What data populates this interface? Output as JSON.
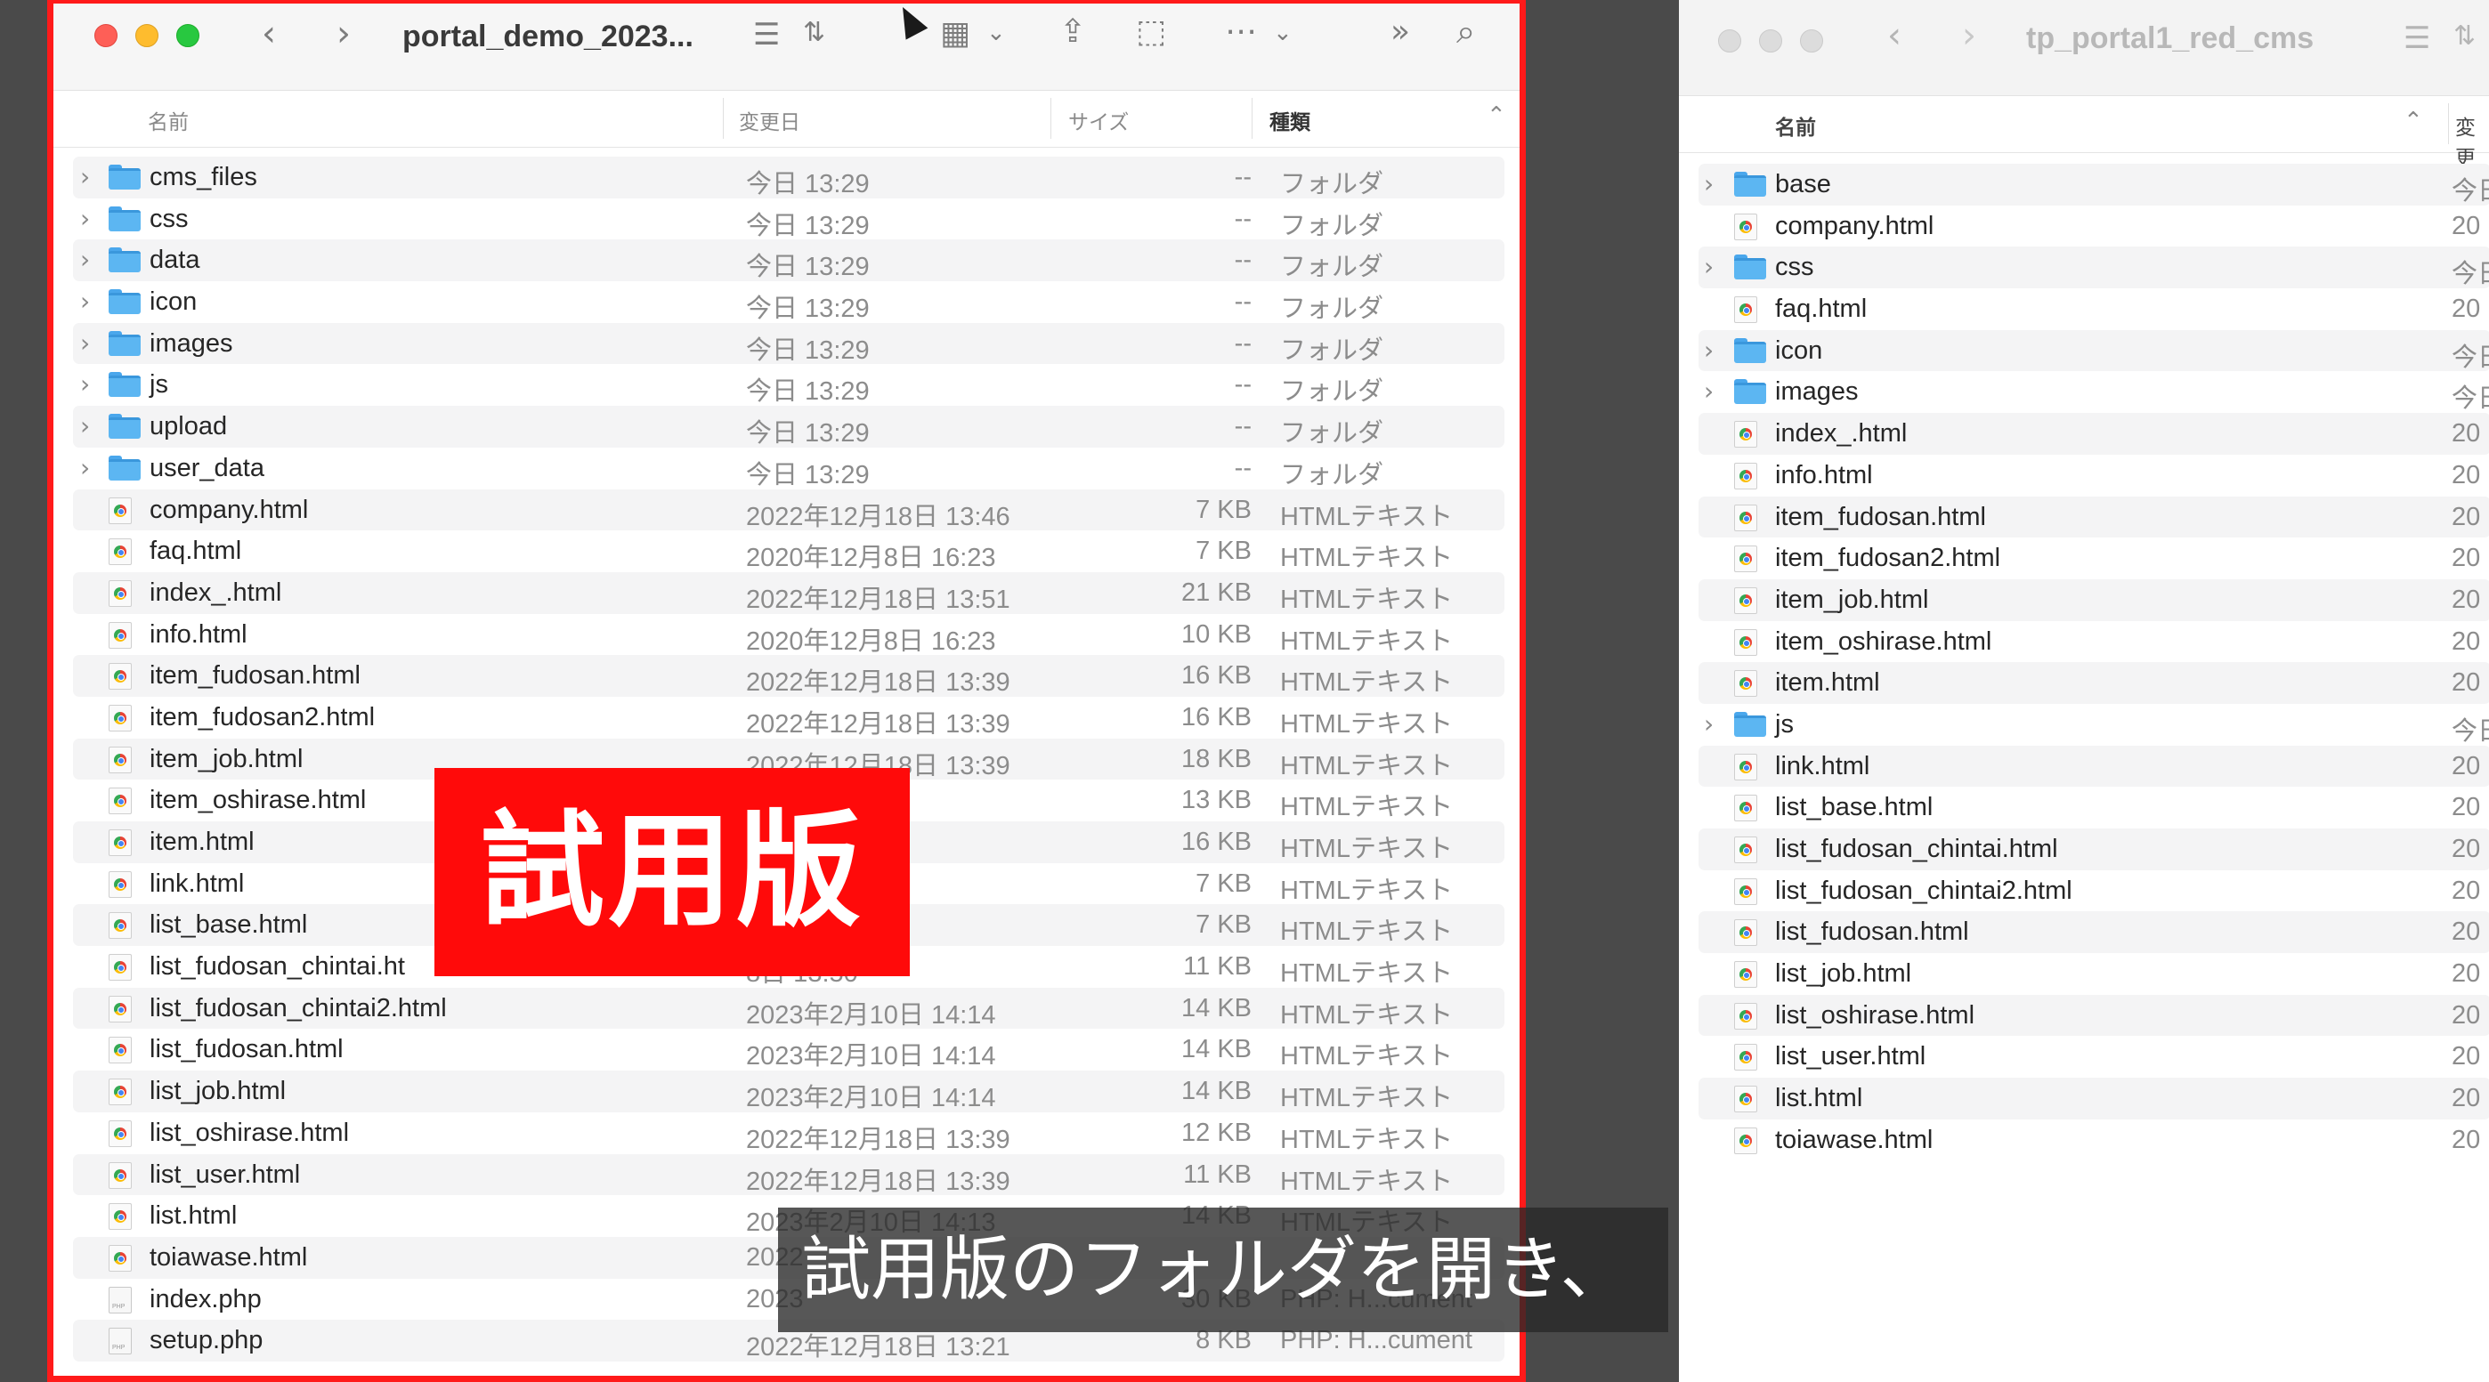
{
  "left_window": {
    "title": "portal_demo_2023...",
    "columns": {
      "name": "名前",
      "date": "変更日",
      "size": "サイズ",
      "kind": "種類"
    },
    "files": [
      {
        "name": "cms_files",
        "date": "今日 13:29",
        "size": "--",
        "kind": "フォルダ",
        "type": "folder"
      },
      {
        "name": "css",
        "date": "今日 13:29",
        "size": "--",
        "kind": "フォルダ",
        "type": "folder"
      },
      {
        "name": "data",
        "date": "今日 13:29",
        "size": "--",
        "kind": "フォルダ",
        "type": "folder"
      },
      {
        "name": "icon",
        "date": "今日 13:29",
        "size": "--",
        "kind": "フォルダ",
        "type": "folder"
      },
      {
        "name": "images",
        "date": "今日 13:29",
        "size": "--",
        "kind": "フォルダ",
        "type": "folder"
      },
      {
        "name": "js",
        "date": "今日 13:29",
        "size": "--",
        "kind": "フォルダ",
        "type": "folder"
      },
      {
        "name": "upload",
        "date": "今日 13:29",
        "size": "--",
        "kind": "フォルダ",
        "type": "folder"
      },
      {
        "name": "user_data",
        "date": "今日 13:29",
        "size": "--",
        "kind": "フォルダ",
        "type": "folder"
      },
      {
        "name": "company.html",
        "date": "2022年12月18日 13:46",
        "size": "7 KB",
        "kind": "HTMLテキスト",
        "type": "html"
      },
      {
        "name": "faq.html",
        "date": "2020年12月8日 16:23",
        "size": "7 KB",
        "kind": "HTMLテキスト",
        "type": "html"
      },
      {
        "name": "index_.html",
        "date": "2022年12月18日 13:51",
        "size": "21 KB",
        "kind": "HTMLテキスト",
        "type": "html"
      },
      {
        "name": "info.html",
        "date": "2020年12月8日 16:23",
        "size": "10 KB",
        "kind": "HTMLテキスト",
        "type": "html"
      },
      {
        "name": "item_fudosan.html",
        "date": "2022年12月18日 13:39",
        "size": "16 KB",
        "kind": "HTMLテキスト",
        "type": "html"
      },
      {
        "name": "item_fudosan2.html",
        "date": "2022年12月18日 13:39",
        "size": "16 KB",
        "kind": "HTMLテキスト",
        "type": "html"
      },
      {
        "name": "item_job.html",
        "date": "2022年12月18日 13:39",
        "size": "18 KB",
        "kind": "HTMLテキスト",
        "type": "html"
      },
      {
        "name": "item_oshirase.html",
        "date": "8日 13:39",
        "size": "13 KB",
        "kind": "HTMLテキスト",
        "type": "html"
      },
      {
        "name": "item.html",
        "date": "8日 13:39",
        "size": "16 KB",
        "kind": "HTMLテキスト",
        "type": "html"
      },
      {
        "name": "link.html",
        "date": "日 16:23",
        "size": "7 KB",
        "kind": "HTMLテキスト",
        "type": "html"
      },
      {
        "name": "list_base.html",
        "date": "日 16:23",
        "size": "7 KB",
        "kind": "HTMLテキスト",
        "type": "html"
      },
      {
        "name": "list_fudosan_chintai.ht",
        "date": "8日 13:50",
        "size": "11 KB",
        "kind": "HTMLテキスト",
        "type": "html"
      },
      {
        "name": "list_fudosan_chintai2.html",
        "date": "2023年2月10日 14:14",
        "size": "14 KB",
        "kind": "HTMLテキスト",
        "type": "html"
      },
      {
        "name": "list_fudosan.html",
        "date": "2023年2月10日 14:14",
        "size": "14 KB",
        "kind": "HTMLテキスト",
        "type": "html"
      },
      {
        "name": "list_job.html",
        "date": "2023年2月10日 14:14",
        "size": "14 KB",
        "kind": "HTMLテキスト",
        "type": "html"
      },
      {
        "name": "list_oshirase.html",
        "date": "2022年12月18日 13:39",
        "size": "12 KB",
        "kind": "HTMLテキスト",
        "type": "html"
      },
      {
        "name": "list_user.html",
        "date": "2022年12月18日 13:39",
        "size": "11 KB",
        "kind": "HTMLテキスト",
        "type": "html"
      },
      {
        "name": "list.html",
        "date": "2023年2月10日 14:13",
        "size": "14 KB",
        "kind": "HTMLテキスト",
        "type": "html"
      },
      {
        "name": "toiawase.html",
        "date": "2022",
        "size": "",
        "kind": "",
        "type": "html"
      },
      {
        "name": "index.php",
        "date": "2023",
        "size": "30 KB",
        "kind": "PHP: H...cument",
        "type": "php"
      },
      {
        "name": "setup.php",
        "date": "2022年12月18日 13:21",
        "size": "8 KB",
        "kind": "PHP: H...cument",
        "type": "php"
      }
    ]
  },
  "right_window": {
    "title": "tp_portal1_red_cms",
    "columns": {
      "name": "名前",
      "date": "変更"
    },
    "files": [
      {
        "name": "base",
        "date": "今日",
        "type": "folder"
      },
      {
        "name": "company.html",
        "date": "20",
        "type": "html"
      },
      {
        "name": "css",
        "date": "今日",
        "type": "folder"
      },
      {
        "name": "faq.html",
        "date": "20",
        "type": "html"
      },
      {
        "name": "icon",
        "date": "今日",
        "type": "folder"
      },
      {
        "name": "images",
        "date": "今日",
        "type": "folder"
      },
      {
        "name": "index_.html",
        "date": "20",
        "type": "html"
      },
      {
        "name": "info.html",
        "date": "20",
        "type": "html"
      },
      {
        "name": "item_fudosan.html",
        "date": "20",
        "type": "html"
      },
      {
        "name": "item_fudosan2.html",
        "date": "20",
        "type": "html"
      },
      {
        "name": "item_job.html",
        "date": "20",
        "type": "html"
      },
      {
        "name": "item_oshirase.html",
        "date": "20",
        "type": "html"
      },
      {
        "name": "item.html",
        "date": "20",
        "type": "html"
      },
      {
        "name": "js",
        "date": "今日",
        "type": "folder"
      },
      {
        "name": "link.html",
        "date": "20",
        "type": "html"
      },
      {
        "name": "list_base.html",
        "date": "20",
        "type": "html"
      },
      {
        "name": "list_fudosan_chintai.html",
        "date": "20",
        "type": "html"
      },
      {
        "name": "list_fudosan_chintai2.html",
        "date": "20",
        "type": "html"
      },
      {
        "name": "list_fudosan.html",
        "date": "20",
        "type": "html"
      },
      {
        "name": "list_job.html",
        "date": "20",
        "type": "html"
      },
      {
        "name": "list_oshirase.html",
        "date": "20",
        "type": "html"
      },
      {
        "name": "list_user.html",
        "date": "20",
        "type": "html"
      },
      {
        "name": "list.html",
        "date": "20",
        "type": "html"
      },
      {
        "name": "toiawase.html",
        "date": "20",
        "type": "html"
      }
    ]
  },
  "overlay": {
    "badge": "試用版",
    "caption": "試用版のフォルダを開き、"
  }
}
